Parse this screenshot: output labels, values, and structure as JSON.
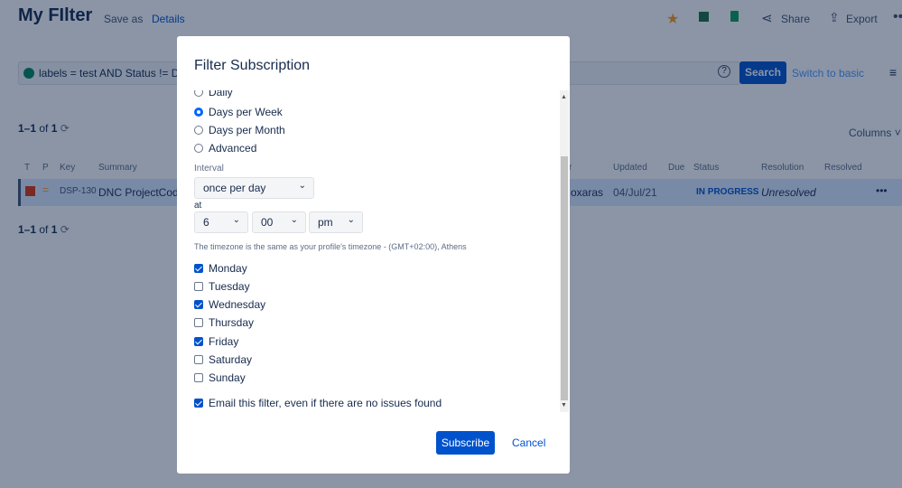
{
  "header": {
    "title": "My FIlter",
    "save_as": "Save as",
    "details": "Details",
    "share": "Share",
    "export": "Export"
  },
  "search": {
    "query": "labels = test AND Status != Dor",
    "button": "Search",
    "switch": "Switch to basic"
  },
  "results": {
    "count_bold": "1–1",
    "count_of": "of",
    "count_total": "1",
    "columns": "Columns"
  },
  "table": {
    "headers": [
      "T",
      "P",
      "Key",
      "Summary",
      "r",
      "Updated",
      "Due",
      "Status",
      "Resolution",
      "Resolved"
    ],
    "row": {
      "key": "DSP-130",
      "summary": "DNC ProjectCode",
      "assignee": "oxaras",
      "updated": "04/Jul/21",
      "status": "IN PROGRESS",
      "resolution": "Unresolved"
    }
  },
  "dialog": {
    "title": "Filter Subscription",
    "frequency": [
      {
        "label": "Daily",
        "selected": false
      },
      {
        "label": "Days per Week",
        "selected": true
      },
      {
        "label": "Days per Month",
        "selected": false
      },
      {
        "label": "Advanced",
        "selected": false
      }
    ],
    "interval_label": "Interval",
    "interval": "once per day",
    "at_label": "at",
    "hour": "6",
    "minute": "00",
    "ampm": "pm",
    "timezone": "The timezone is the same as your profile's timezone - (GMT+02:00), Athens",
    "days": [
      {
        "label": "Monday",
        "checked": true
      },
      {
        "label": "Tuesday",
        "checked": false
      },
      {
        "label": "Wednesday",
        "checked": true
      },
      {
        "label": "Thursday",
        "checked": false
      },
      {
        "label": "Friday",
        "checked": true
      },
      {
        "label": "Saturday",
        "checked": false
      },
      {
        "label": "Sunday",
        "checked": false
      }
    ],
    "email_empty": "Email this filter, even if there are no issues found",
    "email_empty_checked": true,
    "subscribe": "Subscribe",
    "cancel": "Cancel"
  }
}
